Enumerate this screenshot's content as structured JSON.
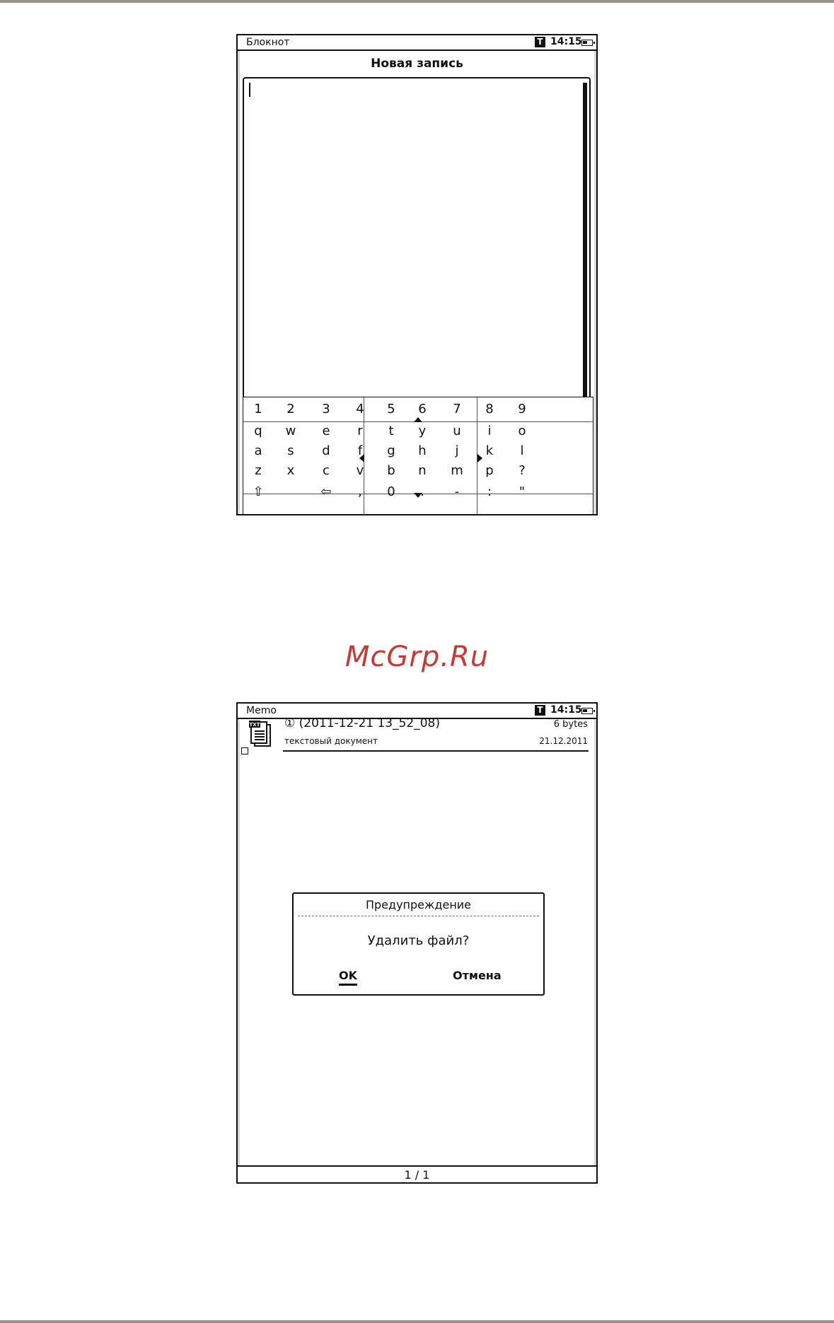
{
  "screen1": {
    "status": {
      "app_name": "Блокнот",
      "t_badge": "T",
      "time": "14:15"
    },
    "title": "Новая запись",
    "keyboard": {
      "rows": [
        [
          "1",
          "2",
          "3",
          "4",
          "5",
          "6",
          "7",
          "8",
          "9"
        ],
        [
          "q",
          "w",
          "e",
          "r",
          "t",
          "y",
          "u",
          "i",
          "o"
        ],
        [
          "a",
          "s",
          "d",
          "f",
          "g",
          "h",
          "j",
          "k",
          "l"
        ],
        [
          "z",
          "x",
          "c",
          "v",
          "b",
          "n",
          "m",
          "p",
          "?"
        ],
        [
          "⇧",
          "",
          "⇦",
          ",",
          "0",
          ".",
          "-",
          ":",
          "\""
        ]
      ]
    }
  },
  "watermark": "McGrp.Ru",
  "screen2": {
    "status": {
      "app_name": "Memo",
      "t_badge": "T",
      "time": "14:15"
    },
    "file": {
      "icon_label": "TXT",
      "name": "① (2011-12-21 13_52_08)",
      "size": "6 bytes",
      "type": "текстовый документ",
      "date": "21.12.2011"
    },
    "dialog": {
      "title": "Предупреждение",
      "message": "Удалить файл?",
      "ok_label": "OK",
      "cancel_label": "Отмена"
    },
    "pagination": "1 / 1"
  }
}
